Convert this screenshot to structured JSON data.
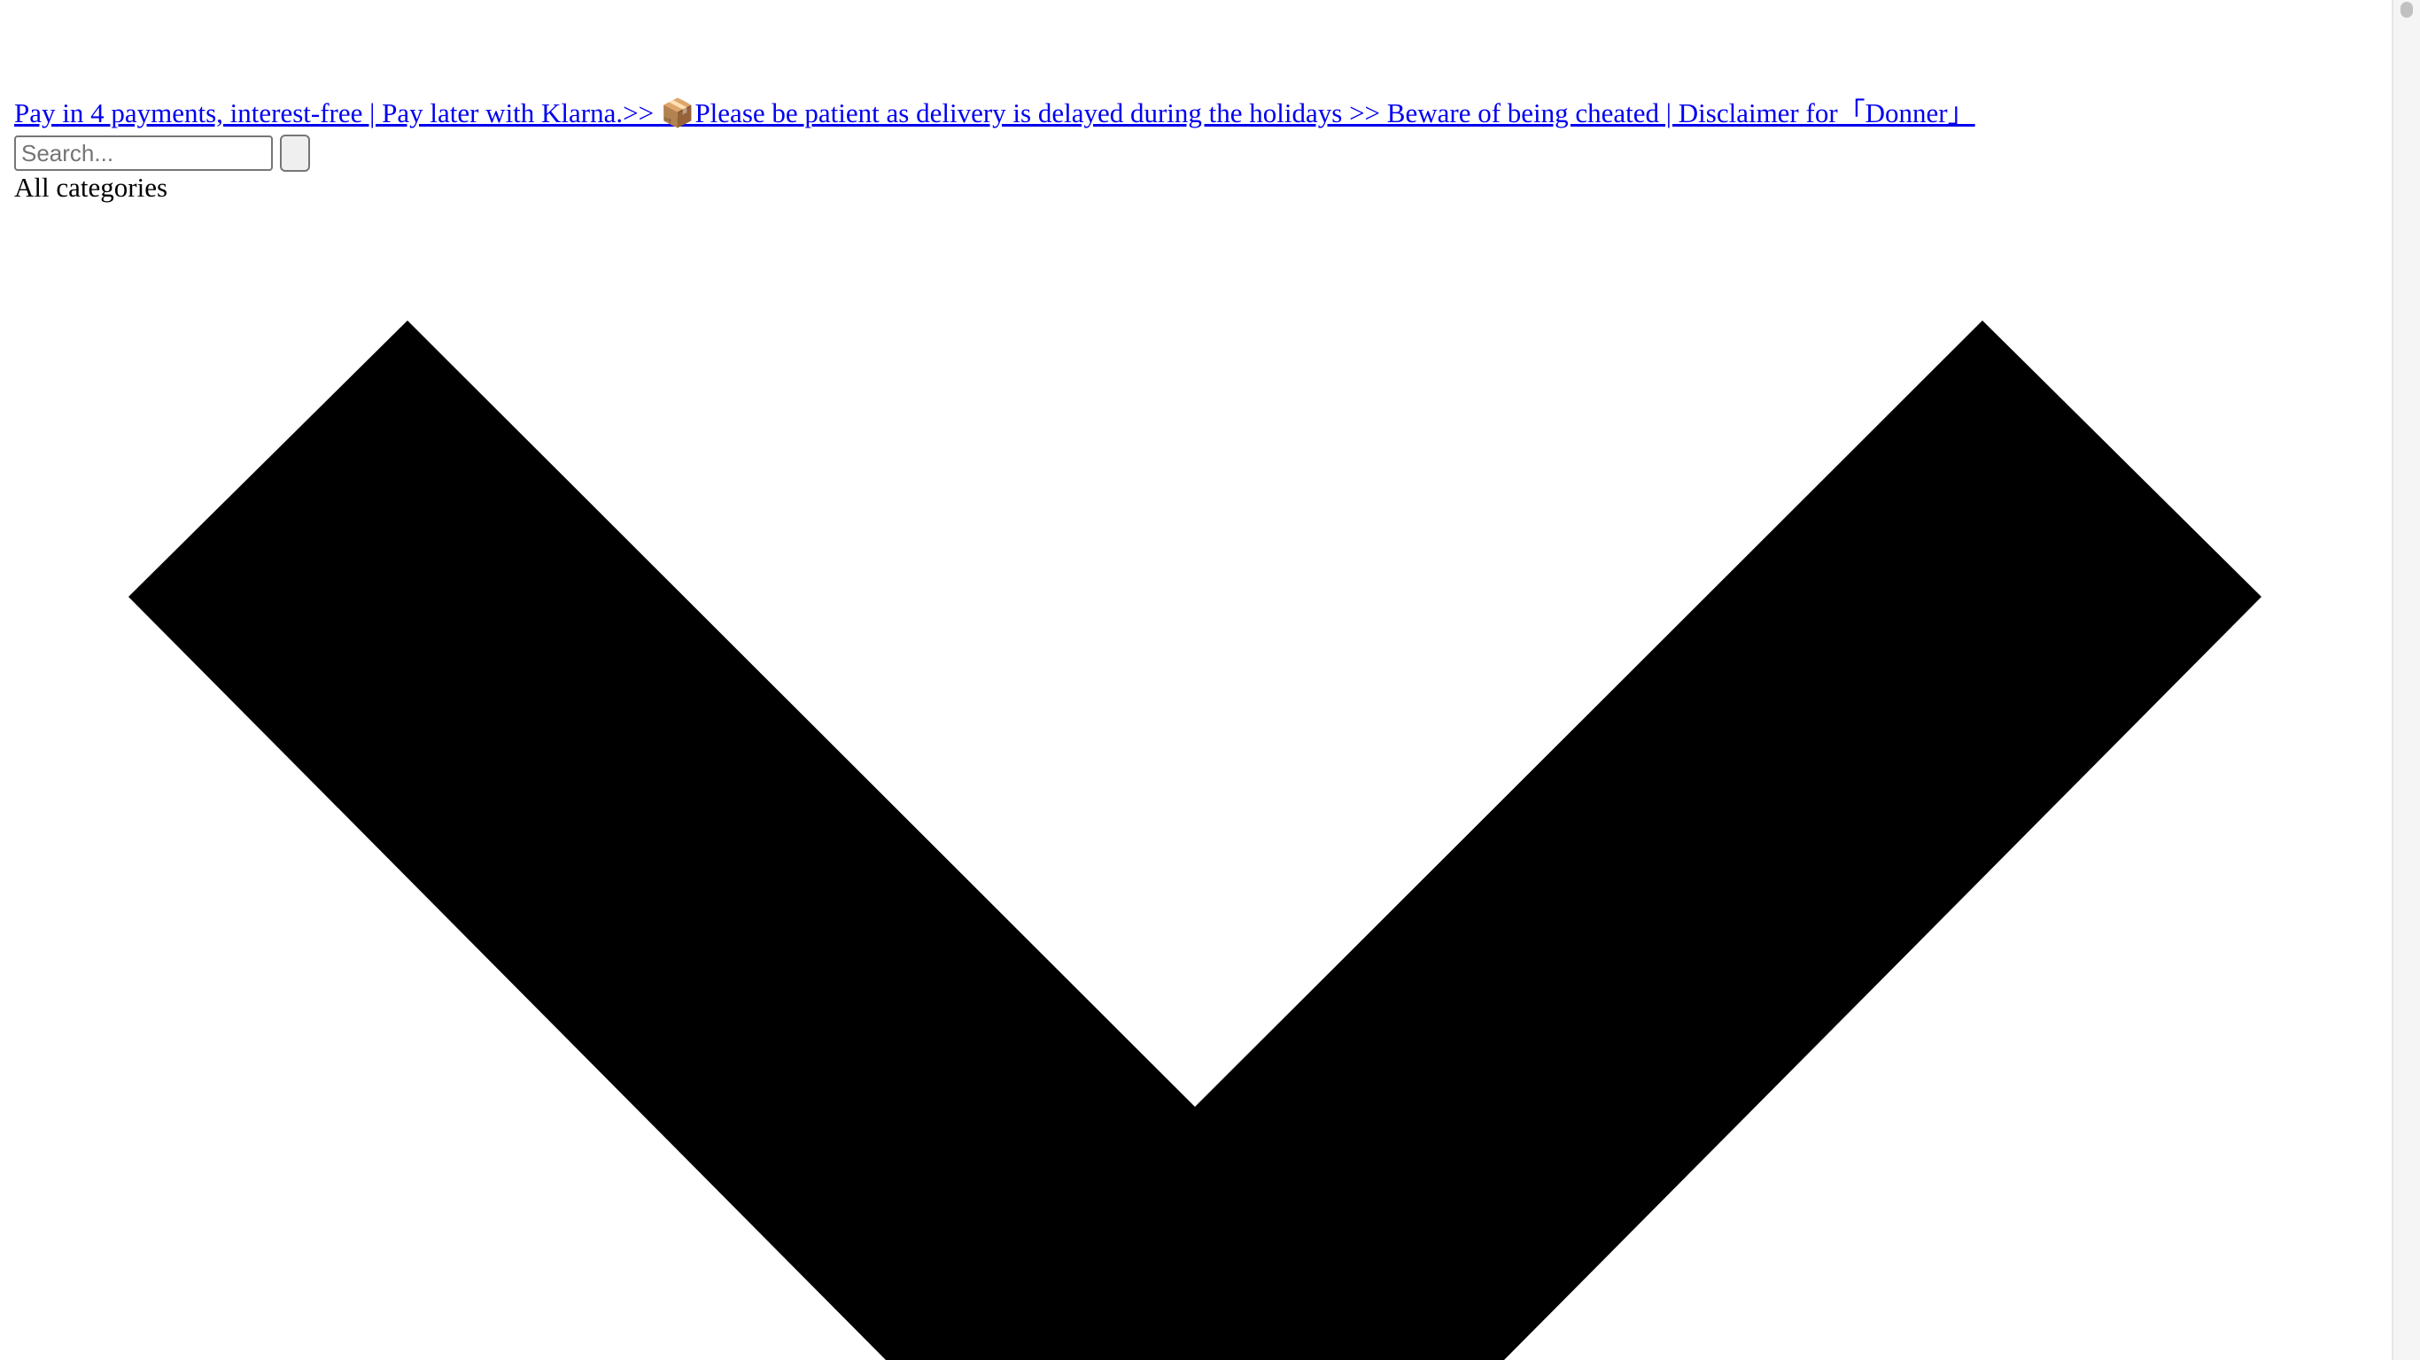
{
  "announcement": {
    "link_text": "Pay in 4 payments, interest-free | Pay later with Klarna.>> 📦Please be patient as delivery is delayed during the holidays >> Beware of being cheated | Disclaimer for「Donner」"
  },
  "search": {
    "placeholder": "Search...",
    "value": ""
  },
  "categories": {
    "label": "All categories",
    "chevron_icon": "chevron-down-icon"
  },
  "colors": {
    "link": "#0000ee",
    "background": "#ffffff",
    "chevron": "#000000"
  }
}
